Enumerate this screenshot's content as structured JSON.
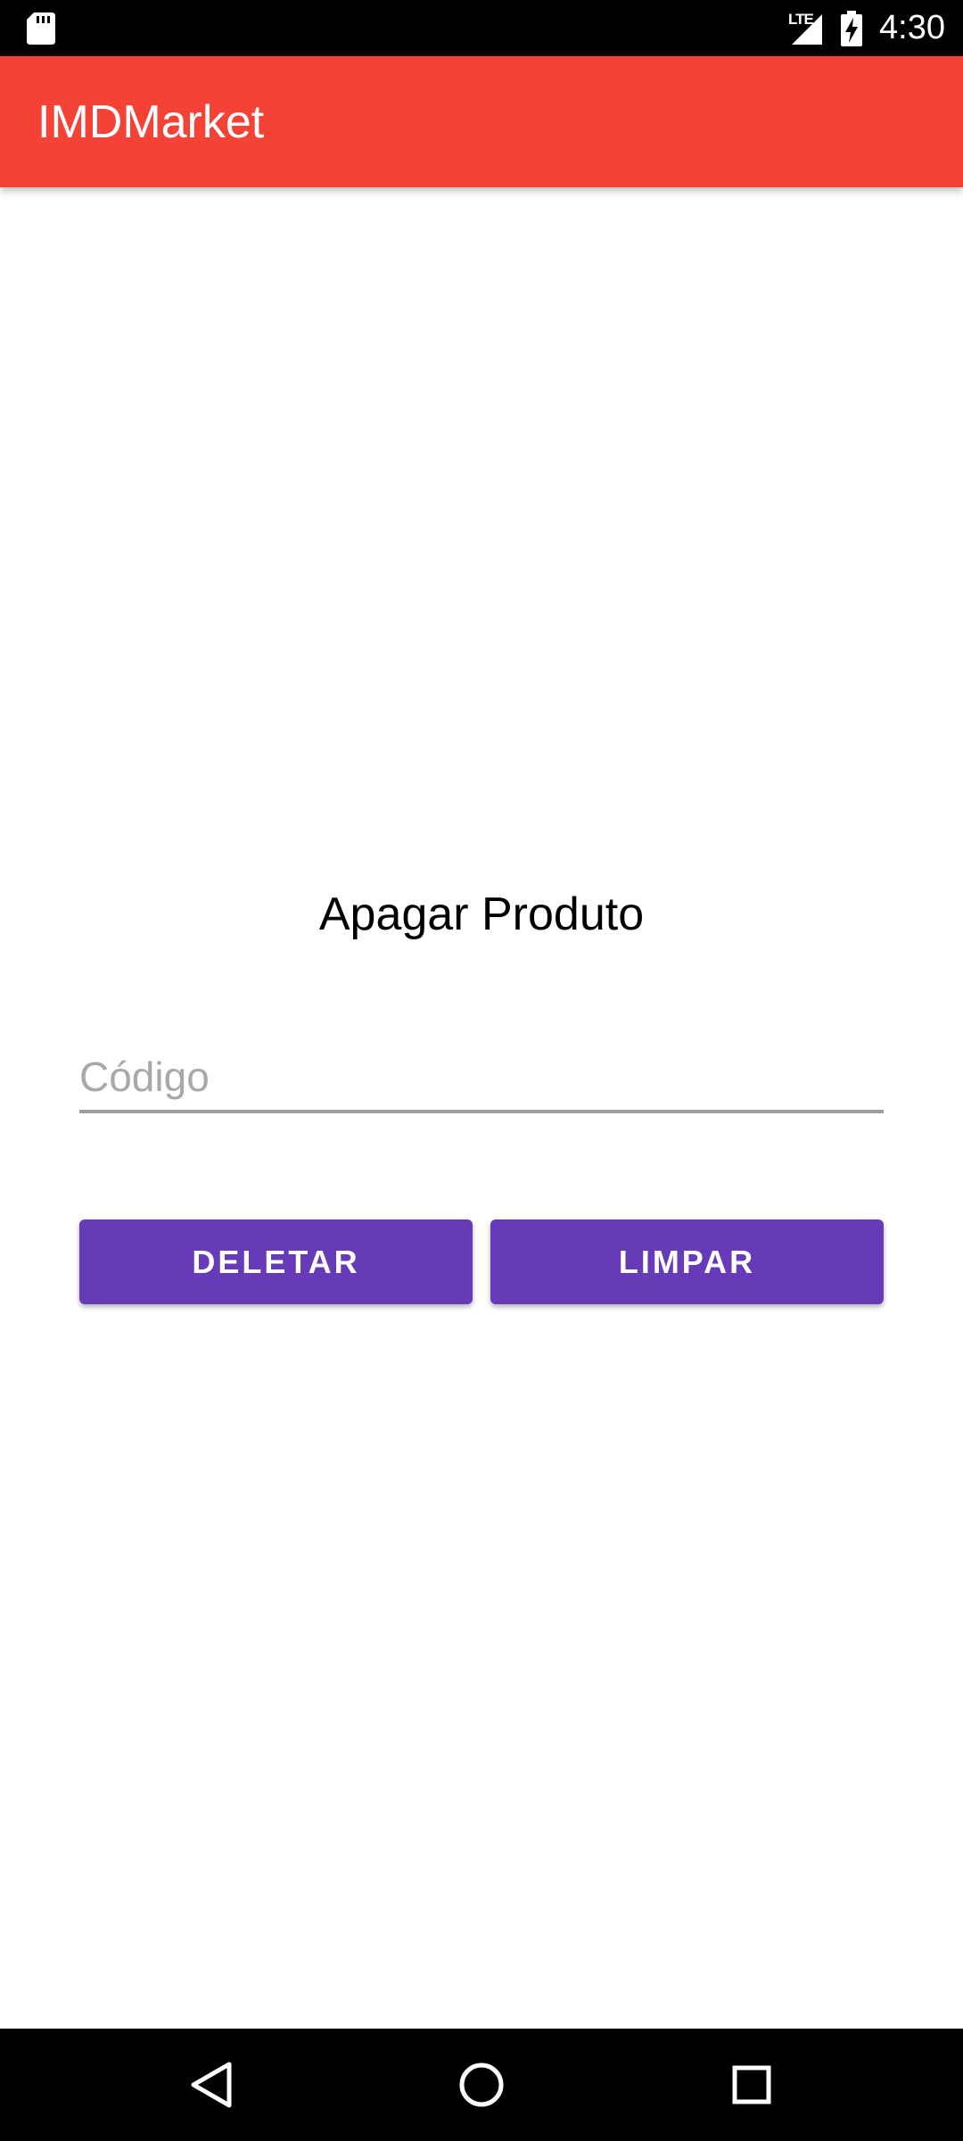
{
  "status_bar": {
    "time": "4:30",
    "network_label": "LTE",
    "icons": [
      "sd-card-icon",
      "signal-icon",
      "battery-charging-icon"
    ]
  },
  "app_bar": {
    "title": "IMDMarket",
    "color": "#f44336"
  },
  "form": {
    "title": "Apagar Produto",
    "code_placeholder": "Código",
    "code_value": "",
    "delete_label": "DELETAR",
    "clear_label": "LIMPAR",
    "button_color": "#673ab7"
  },
  "nav_bar": {
    "icons": [
      "back-icon",
      "home-icon",
      "recents-icon"
    ]
  }
}
